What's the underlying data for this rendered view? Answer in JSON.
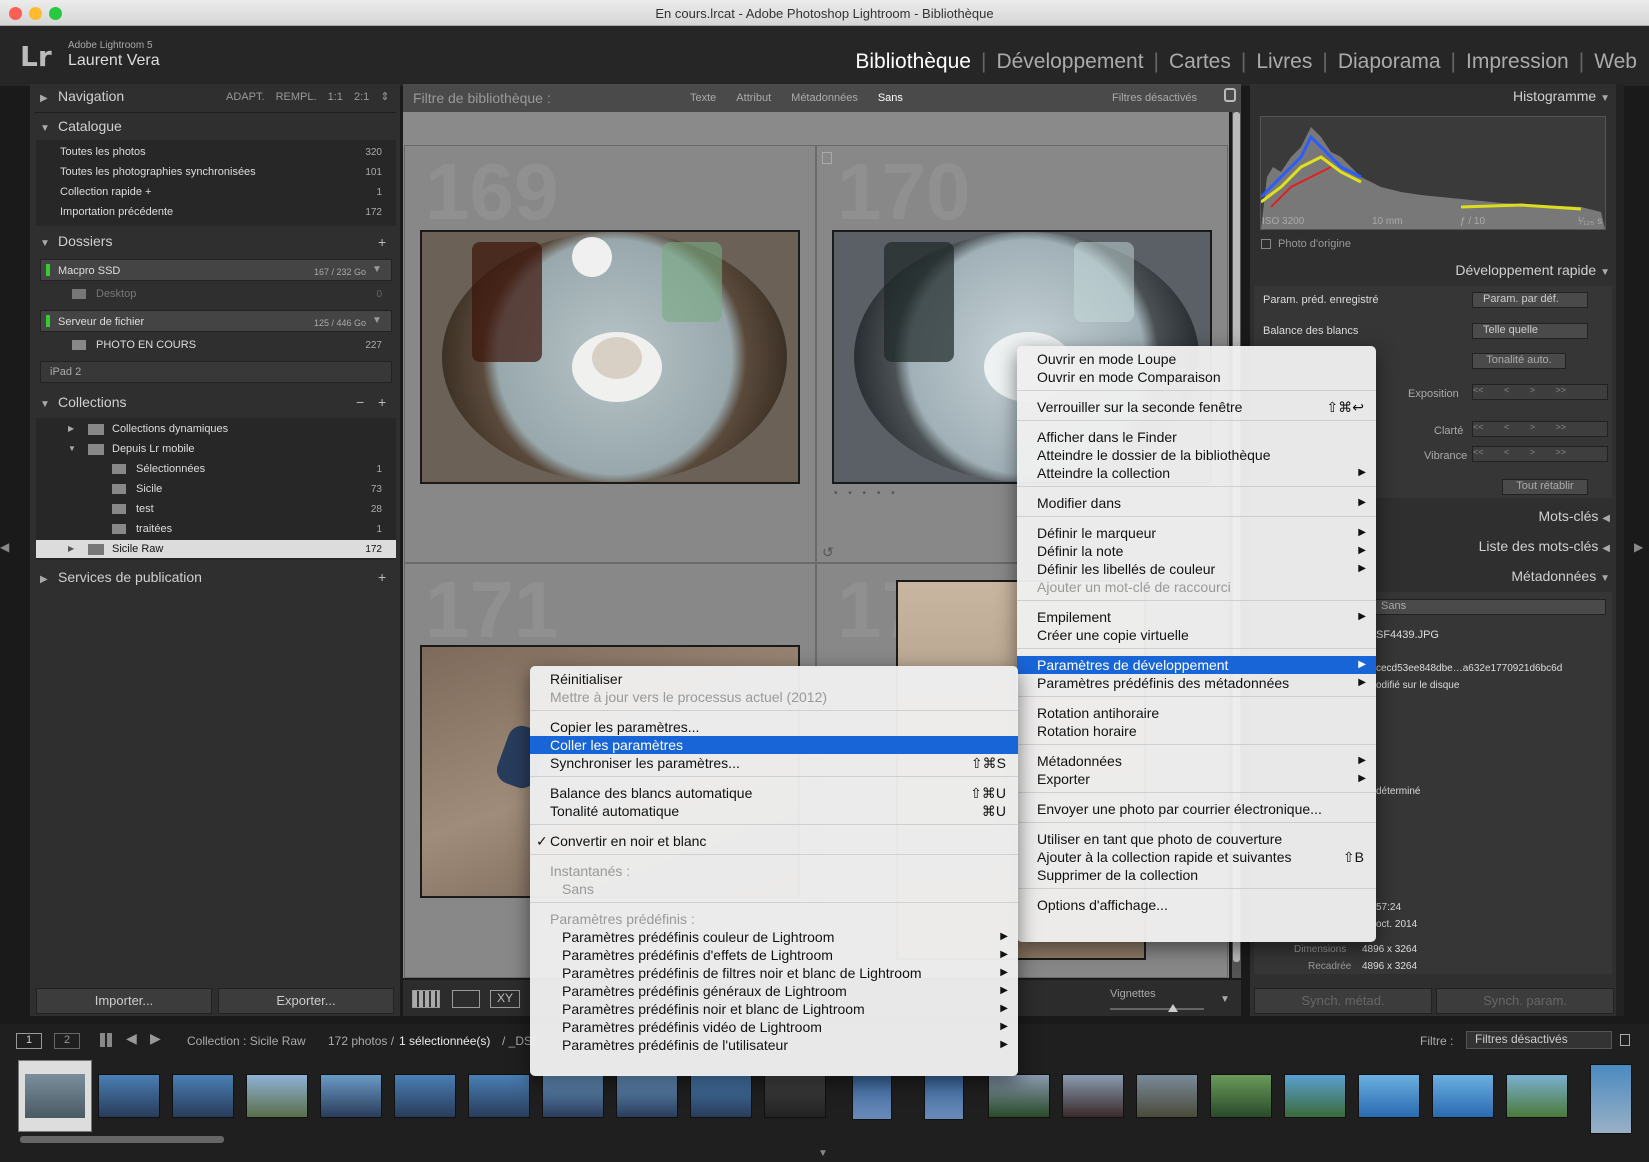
{
  "window": {
    "title": "En cours.lrcat - Adobe Photoshop Lightroom - Bibliothèque"
  },
  "identity": {
    "logo": "Lr",
    "app": "Adobe Lightroom 5",
    "user": "Laurent Vera"
  },
  "modules": [
    "Bibliothèque",
    "Développement",
    "Cartes",
    "Livres",
    "Diaporama",
    "Impression",
    "Web"
  ],
  "left": {
    "navigator": {
      "label": "Navigation",
      "options": [
        "ADAPT.",
        "REMPL.",
        "1:1",
        "2:1"
      ]
    },
    "catalog": {
      "label": "Catalogue",
      "items": [
        {
          "label": "Toutes les photos",
          "count": "320"
        },
        {
          "label": "Toutes les photographies synchronisées",
          "count": "101"
        },
        {
          "label": "Collection rapide +",
          "count": "1"
        },
        {
          "label": "Importation précédente",
          "count": "172"
        }
      ]
    },
    "folders": {
      "label": "Dossiers",
      "volume1": {
        "name": "Macpro SSD",
        "size": "167 / 232 Go"
      },
      "desktop": {
        "name": "Desktop",
        "count": "0"
      },
      "volume2": {
        "name": "Serveur de fichier",
        "size": "125 / 446 Go"
      },
      "photo_en_cours": {
        "name": "PHOTO EN COURS",
        "count": "227"
      },
      "volume3": {
        "name": "iPad 2"
      }
    },
    "collections": {
      "label": "Collections",
      "items": [
        {
          "label": "Collections dynamiques",
          "count": ""
        },
        {
          "label": "Depuis Lr mobile",
          "count": ""
        },
        {
          "label": "Sélectionnées",
          "count": "1"
        },
        {
          "label": "Sicile",
          "count": "73"
        },
        {
          "label": "test",
          "count": "28"
        },
        {
          "label": "traitées",
          "count": "1"
        },
        {
          "label": "Sicile Raw",
          "count": "172"
        }
      ]
    },
    "publish": {
      "label": "Services de publication"
    },
    "import_button": "Importer...",
    "export_button": "Exporter..."
  },
  "filter_bar": {
    "label": "Filtre de bibliothèque :",
    "tabs": [
      "Texte",
      "Attribut",
      "Métadonnées",
      "Sans"
    ],
    "status": "Filtres désactivés"
  },
  "grid": {
    "cells": [
      "169",
      "170",
      "171",
      "172"
    ]
  },
  "toolbar": {
    "vignettes": "Vignettes"
  },
  "right": {
    "histogram": {
      "label": "Histogramme",
      "iso": "ISO 3200",
      "focal": "10 mm",
      "aperture": "ƒ / 10",
      "shutter": "¹⁄₁₂₅ s",
      "original": "Photo d'origine"
    },
    "quick_develop": {
      "label": "Développement rapide",
      "preset_label": "Param. préd. enregistré",
      "preset_value": "Param. par déf.",
      "wb_label": "Balance des blancs",
      "wb_value": "Telle quelle",
      "auto_tone": "Tonalité auto.",
      "exposure": "Exposition",
      "clarity": "Clarté",
      "vibrance": "Vibrance",
      "reset": "Tout rétablir"
    },
    "keywords": "Mots-clés",
    "keyword_list": "Liste des mots-clés",
    "metadata": {
      "label": "Métadonnées",
      "preset": "Sans",
      "filename": "SF4439.JPG",
      "hash": "cecd53ee848dbe…a632e1770921d6bc6d",
      "disk": "odifié sur le disque",
      "undetermined": "déterminé",
      "time": "57:24",
      "date": "oct. 2014",
      "dim_label": "Dimensions",
      "dim_value": "4896 x 3264",
      "crop_label": "Recadrée",
      "crop_value": "4896 x 3264"
    },
    "sync_meta": "Synch. métad.",
    "sync_param": "Synch. param."
  },
  "filmstrip": {
    "page1": "1",
    "page2": "2",
    "source": "Collection : Sicile Raw",
    "count": "172 photos /",
    "selected": "1 sélectionnée(s)",
    "filename": "/ _DSF",
    "filter_label": "Filtre :",
    "filter_value": "Filtres désactivés"
  },
  "context_menu": {
    "items": [
      {
        "label": "Ouvrir en mode Loupe"
      },
      {
        "label": "Ouvrir en mode Comparaison"
      },
      {
        "label": "Verrouiller sur la seconde fenêtre",
        "shortcut": "⇧⌘↩"
      },
      {
        "label": "Afficher dans le Finder"
      },
      {
        "label": "Atteindre le dossier de la bibliothèque"
      },
      {
        "label": "Atteindre la collection"
      },
      {
        "label": "Modifier dans"
      },
      {
        "label": "Définir le marqueur"
      },
      {
        "label": "Définir la note"
      },
      {
        "label": "Définir les libellés de couleur"
      },
      {
        "label": "Ajouter un mot-clé de raccourci"
      },
      {
        "label": "Empilement"
      },
      {
        "label": "Créer une copie virtuelle"
      },
      {
        "label": "Paramètres de développement"
      },
      {
        "label": "Paramètres prédéfinis des métadonnées"
      },
      {
        "label": "Rotation antihoraire"
      },
      {
        "label": "Rotation horaire"
      },
      {
        "label": "Métadonnées"
      },
      {
        "label": "Exporter"
      },
      {
        "label": "Envoyer une photo par courrier électronique..."
      },
      {
        "label": "Utiliser en tant que photo de couverture"
      },
      {
        "label": "Ajouter à la collection rapide et suivantes",
        "shortcut": "⇧B"
      },
      {
        "label": "Supprimer de la collection"
      },
      {
        "label": "Options d'affichage..."
      }
    ]
  },
  "submenu": {
    "items": [
      {
        "label": "Réinitialiser"
      },
      {
        "label": "Mettre à jour vers le processus actuel (2012)"
      },
      {
        "label": "Copier les paramètres..."
      },
      {
        "label": "Coller les paramètres"
      },
      {
        "label": "Synchroniser les paramètres...",
        "shortcut": "⇧⌘S"
      },
      {
        "label": "Balance des blancs automatique",
        "shortcut": "⇧⌘U"
      },
      {
        "label": "Tonalité automatique",
        "shortcut": "⌘U"
      },
      {
        "label": "Convertir en noir et blanc"
      },
      {
        "label": "Instantanés :"
      },
      {
        "label": "Sans"
      },
      {
        "label": "Paramètres prédéfinis :"
      },
      {
        "label": "Paramètres prédéfinis couleur de Lightroom"
      },
      {
        "label": "Paramètres prédéfinis d'effets de Lightroom"
      },
      {
        "label": "Paramètres prédéfinis de filtres noir et blanc de Lightroom"
      },
      {
        "label": "Paramètres prédéfinis généraux de Lightroom"
      },
      {
        "label": "Paramètres prédéfinis noir et blanc de Lightroom"
      },
      {
        "label": "Paramètres prédéfinis vidéo de Lightroom"
      },
      {
        "label": "Paramètres prédéfinis de l'utilisateur"
      }
    ]
  },
  "colors": {
    "selection": "#1865d8",
    "panel": "#2f2f2f",
    "grid_bg": "#8a8a8a"
  }
}
